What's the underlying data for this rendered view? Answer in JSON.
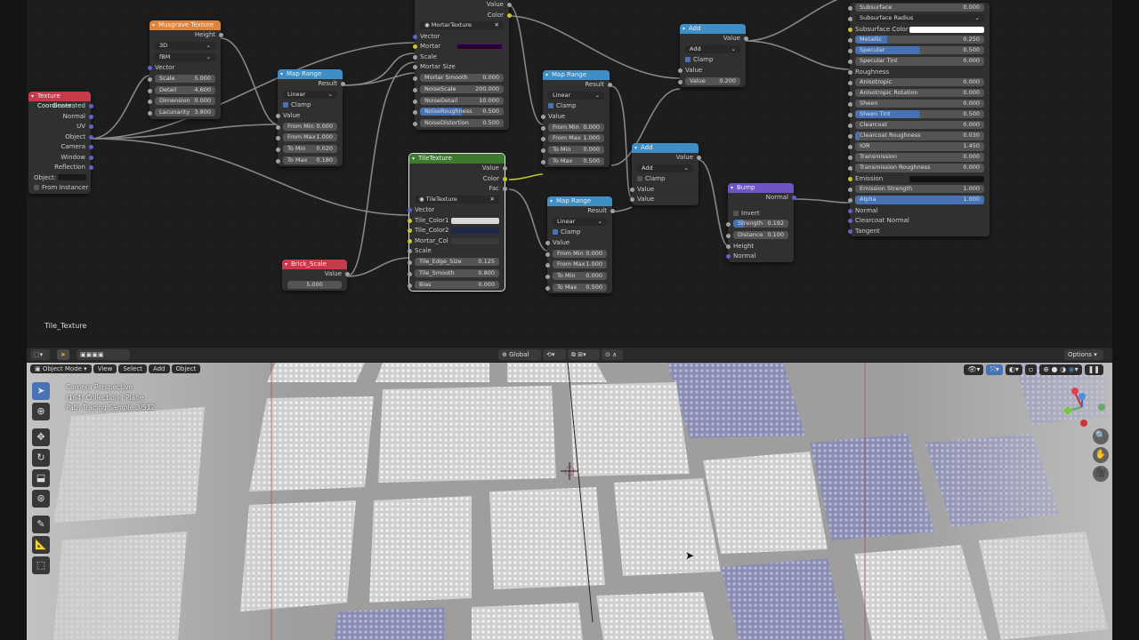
{
  "colors": {
    "accent": "#4772b3",
    "texture_header": "#e0843a",
    "converter_header": "#3f8fc6",
    "input_header": "#c53b4a",
    "vector_header": "#6f55c4",
    "tile_header": "#3d7a30"
  },
  "node_editor": {
    "frame_label": "Tile_Texture",
    "tex_coord": {
      "title": "Texture Coordinate",
      "outputs": [
        "Generated",
        "Normal",
        "UV",
        "Object",
        "Camera",
        "Window",
        "Reflection"
      ],
      "object_label": "Object:",
      "from_instancer": "From Instancer"
    },
    "musgrave": {
      "title": "Musgrave Texture",
      "height": "Height",
      "dim": "3D",
      "type": "fBM",
      "vector": "Vector",
      "fields": [
        {
          "k": "Scale",
          "v": "5.000"
        },
        {
          "k": "Detail",
          "v": "4.600"
        },
        {
          "k": "Dimension",
          "v": "0.000"
        },
        {
          "k": "Lacunarity",
          "v": "3.800"
        }
      ]
    },
    "maprange1": {
      "title": "Map Range",
      "result": "Result",
      "interp": "Linear",
      "clamp": "Clamp",
      "value": "Value",
      "fields": [
        {
          "k": "From Min",
          "v": "0.000"
        },
        {
          "k": "From Max",
          "v": "1.000"
        },
        {
          "k": "To Min",
          "v": "0.020"
        },
        {
          "k": "To Max",
          "v": "0.180"
        }
      ]
    },
    "mortar": {
      "value": "Value",
      "color": "Color",
      "name": "MortarTexture",
      "vector": "Vector",
      "mortar": "Mortar",
      "scale": "Scale",
      "mortar_size": "Mortar Size",
      "fields": [
        {
          "k": "Mortar Smooth",
          "v": "0.000"
        },
        {
          "k": "NoiseScale",
          "v": "200.000"
        },
        {
          "k": "NoiseDetail",
          "v": "10.000"
        },
        {
          "k": "NoiseRoughness",
          "v": "0.500"
        },
        {
          "k": "NoiseDistortion",
          "v": "0.500"
        }
      ]
    },
    "maprange2": {
      "title": "Map Range",
      "result": "Result",
      "interp": "Linear",
      "clamp": "Clamp",
      "value": "Value",
      "fields": [
        {
          "k": "From Min",
          "v": "0.000"
        },
        {
          "k": "From Max",
          "v": "1.000"
        },
        {
          "k": "To Min",
          "v": "0.000"
        },
        {
          "k": "To Max",
          "v": "0.500"
        }
      ]
    },
    "add1": {
      "title": "Add",
      "value": "Value",
      "op": "Add",
      "clamp": "Clamp",
      "in": "Value",
      "field": {
        "k": "Value",
        "v": "0.200"
      }
    },
    "add2": {
      "title": "Add",
      "value": "Value",
      "op": "Add",
      "clamp": "Clamp",
      "in1": "Value",
      "in2": "Value"
    },
    "tile": {
      "title": "TileTexture",
      "value": "Value",
      "color": "Color",
      "fac": "Fac",
      "name": "TileTexture",
      "vector": "Vector",
      "c1": "Tile_Color1",
      "c2": "Tile_Color2",
      "mc": "Mortar_Col",
      "scale": "Scale",
      "fields": [
        {
          "k": "Tile_Edge_Size",
          "v": "0.125"
        },
        {
          "k": "Tile_Smooth",
          "v": "0.800"
        },
        {
          "k": "Bias",
          "v": "0.000"
        }
      ]
    },
    "maprange3": {
      "title": "Map Range",
      "result": "Result",
      "interp": "Linear",
      "clamp": "Clamp",
      "value": "Value",
      "fields": [
        {
          "k": "From Min",
          "v": "0.000"
        },
        {
          "k": "From Max",
          "v": "1.000"
        },
        {
          "k": "To Min",
          "v": "0.000"
        },
        {
          "k": "To Max",
          "v": "0.500"
        }
      ]
    },
    "brick_scale": {
      "title": "Brick_Scale",
      "value": "Value",
      "field": "5.000"
    },
    "bump": {
      "title": "Bump",
      "normal": "Normal",
      "invert": "Invert",
      "fields": [
        {
          "k": "Strength",
          "v": "0.192"
        },
        {
          "k": "Distance",
          "v": "0.100"
        }
      ],
      "height": "Height",
      "normal_in": "Normal"
    },
    "bsdf": {
      "fields": [
        {
          "k": "Subsurface",
          "v": "0.000",
          "f": 0
        },
        {
          "k": "Subsurface Radius",
          "v": "",
          "f": 0,
          "dd": true
        },
        {
          "k": "Subsurface Color",
          "v": "",
          "f": 0,
          "sw": "#ffffff"
        },
        {
          "k": "Metallic",
          "v": "0.250",
          "f": 0.25
        },
        {
          "k": "Specular",
          "v": "0.500",
          "f": 0.5
        },
        {
          "k": "Specular Tint",
          "v": "0.000",
          "f": 0
        },
        {
          "k": "Roughness",
          "v": "",
          "f": 0,
          "label": true
        },
        {
          "k": "Anisotropic",
          "v": "0.000",
          "f": 0
        },
        {
          "k": "Anisotropic Rotation",
          "v": "0.000",
          "f": 0
        },
        {
          "k": "Sheen",
          "v": "0.000",
          "f": 0
        },
        {
          "k": "Sheen Tint",
          "v": "0.500",
          "f": 0.5
        },
        {
          "k": "Clearcoat",
          "v": "0.000",
          "f": 0
        },
        {
          "k": "Clearcoat Roughness",
          "v": "0.030",
          "f": 0.03
        },
        {
          "k": "IOR",
          "v": "1.450",
          "f": 0
        },
        {
          "k": "Transmission",
          "v": "0.000",
          "f": 0
        },
        {
          "k": "Transmission Roughness",
          "v": "0.000",
          "f": 0
        },
        {
          "k": "Emission",
          "v": "",
          "f": 0,
          "sw": "#111111"
        },
        {
          "k": "Emission Strength",
          "v": "1.000",
          "f": 0
        },
        {
          "k": "Alpha",
          "v": "1.000",
          "f": 1
        },
        {
          "k": "Normal",
          "v": "",
          "f": 0,
          "label": true
        },
        {
          "k": "Clearcoat Normal",
          "v": "",
          "f": 0,
          "label": true
        },
        {
          "k": "Tangent",
          "v": "",
          "f": 0,
          "label": true
        }
      ]
    }
  },
  "viewport": {
    "header": {
      "transform": "Global",
      "options": "Options"
    },
    "menu": {
      "mode": "Object Mode",
      "view": "View",
      "select": "Select",
      "add": "Add",
      "object": "Object"
    },
    "overlay": {
      "line1": "Camera Perspective",
      "line2": "(164) Collection | Plane",
      "line3": "Path Tracing Sample 3/512"
    }
  }
}
